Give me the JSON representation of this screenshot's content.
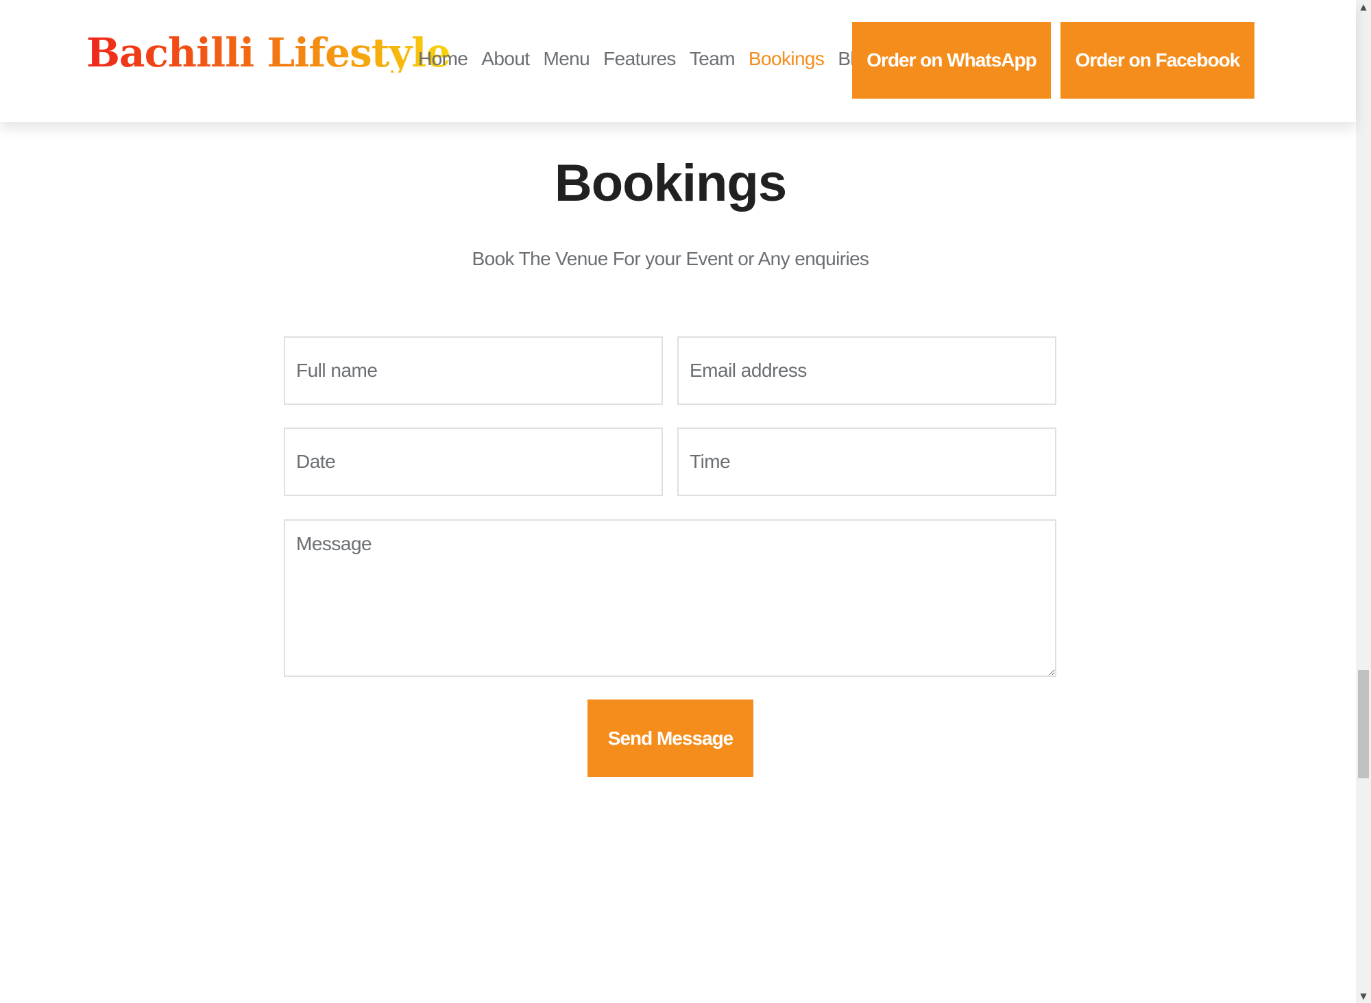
{
  "header": {
    "logo": "Bachilli Lifestyle",
    "nav": {
      "home": "Home",
      "about": "About",
      "menu": "Menu",
      "features": "Features",
      "team": "Team",
      "bookings": "Bookings",
      "blog": "Blog"
    },
    "active_nav": "Bookings",
    "order_whatsapp": "Order on WhatsApp",
    "order_facebook": "Order on Facebook"
  },
  "bookings": {
    "title": "Bookings",
    "subtitle": "Book The Venue For your Event or Any enquiries",
    "form": {
      "full_name_placeholder": "Full name",
      "email_placeholder": "Email address",
      "date_placeholder": "Date",
      "time_placeholder": "Time",
      "message_placeholder": "Message",
      "submit_label": "Send Message"
    }
  },
  "scrollbar": {
    "up_icon": "triangle-up-icon",
    "down_icon": "triangle-down-icon"
  },
  "colors": {
    "accent": "#f58d1c",
    "logo_gradient_start": "#f0261a",
    "logo_gradient_end": "#f7d40c",
    "text_muted": "#6b6f74",
    "heading": "#212121"
  }
}
